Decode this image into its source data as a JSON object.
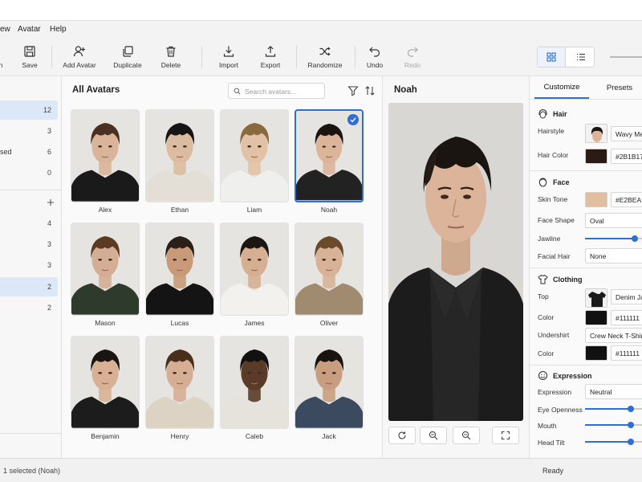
{
  "menu": [
    "ew",
    "Avatar",
    "Help"
  ],
  "toolbar": {
    "save": "Save",
    "add_avatar": "Add Avatar",
    "duplicate": "Duplicate",
    "delete": "Delete",
    "import": "Import",
    "export": "Export",
    "randomize": "Randomize",
    "undo": "Undo",
    "redo": "Redo"
  },
  "sidebar": {
    "counts": [
      "12",
      "3",
      "6",
      "0",
      "4",
      "3",
      "3",
      "2",
      "2"
    ],
    "partial_label": "sed"
  },
  "gallery": {
    "title": "All Avatars",
    "search_placeholder": "Search avatars...",
    "avatars": [
      {
        "name": "Alex",
        "hair": "#4a3020",
        "skin": "#d9b49a",
        "top": "#1a1a1a"
      },
      {
        "name": "Ethan",
        "hair": "#151515",
        "skin": "#dcbca0",
        "top": "#e4dfd6"
      },
      {
        "name": "Liam",
        "hair": "#8a6a3d",
        "skin": "#e2c2a6",
        "top": "#efefed"
      },
      {
        "name": "Noah",
        "hair": "#1b1512",
        "skin": "#dcb49a",
        "top": "#222222"
      },
      {
        "name": "Mason",
        "hair": "#5a3a22",
        "skin": "#d4ae94",
        "top": "#2e3a2c"
      },
      {
        "name": "Lucas",
        "hair": "#2a2018",
        "skin": "#c89a78",
        "top": "#141414"
      },
      {
        "name": "James",
        "hair": "#1c1613",
        "skin": "#d6ae92",
        "top": "#f3f1ee"
      },
      {
        "name": "Oliver",
        "hair": "#6a4a2c",
        "skin": "#d8b296",
        "top": "#a08a70"
      },
      {
        "name": "Benjamin",
        "hair": "#1a1512",
        "skin": "#d8b094",
        "top": "#1c1c1c"
      },
      {
        "name": "Henry",
        "hair": "#4a2e1c",
        "skin": "#d6ae94",
        "top": "#ddd3c4"
      },
      {
        "name": "Caleb",
        "hair": "#111111",
        "skin": "#5a3b28",
        "top": "#e6e2dc"
      },
      {
        "name": "Jack",
        "hair": "#1a1411",
        "skin": "#c99e80",
        "top": "#3c4a60"
      }
    ]
  },
  "preview": {
    "title": "Noah"
  },
  "props": {
    "tabs": [
      "Customize",
      "Presets"
    ],
    "hair": {
      "title": "Hair",
      "hairstyle_label": "Hairstyle",
      "hairstyle_value": "Wavy Me",
      "color_label": "Hair Color",
      "color_value": "#2B1B17",
      "color_hex": "#2b1b17"
    },
    "face": {
      "title": "Face",
      "skin_label": "Skin Tone",
      "skin_value": "#E2BEA1",
      "skin_hex": "#e2bea1",
      "shape_label": "Face Shape",
      "shape_value": "Oval",
      "jawline_label": "Jawline",
      "jawline_level": 0.88,
      "facial_hair_label": "Facial Hair",
      "facial_hair_value": "None"
    },
    "clothing": {
      "title": "Clothing",
      "top_label": "Top",
      "top_value": "Denim Ja",
      "color_label": "Color",
      "color_value": "#111111",
      "color_hex": "#111111",
      "undershirt_label": "Undershirt",
      "undershirt_value": "Crew Neck T-Shirt",
      "color2_label": "Color",
      "color2_value": "#111111",
      "color2_hex": "#111111"
    },
    "expression": {
      "title": "Expression",
      "expression_label": "Expression",
      "expression_value": "Neutral",
      "eye_label": "Eye Openness",
      "eye_level": 0.8,
      "mouth_label": "Mouth",
      "mouth_level": 0.8,
      "tilt_label": "Head Tilt",
      "tilt_level": 0.8
    }
  },
  "status": {
    "left": "1 selected (Noah)",
    "right": "Ready"
  },
  "accent": "#2f6fd0"
}
